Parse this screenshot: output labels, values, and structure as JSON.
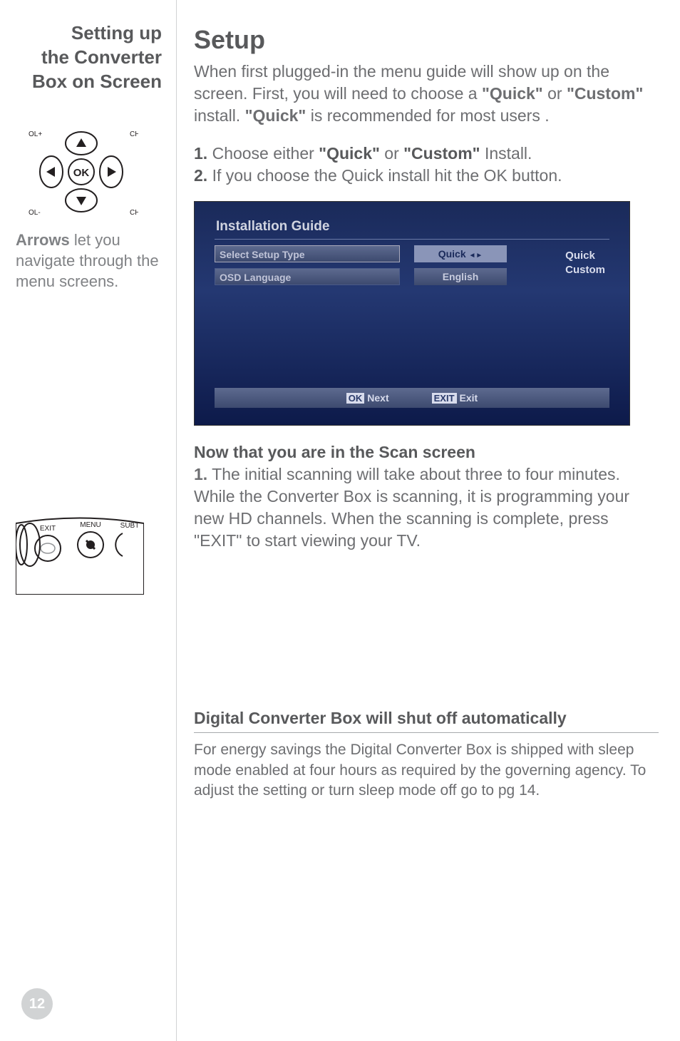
{
  "sidebar": {
    "title_line1": "Setting up",
    "title_line2": "the Converter",
    "title_line3": "Box on Screen",
    "arrows_desc_prefix": "Arrows",
    "arrows_desc_rest": " let you navigate through the menu screens.",
    "remote_labels": {
      "exit": "EXIT",
      "menu": "MENU",
      "subt": "SUBT"
    },
    "dpad_labels": {
      "ok": "OK",
      "volup": "OL+",
      "voldn": "OL-",
      "chup": "CH",
      "chdn": "CH"
    }
  },
  "main": {
    "h1": "Setup",
    "intro_pre": "When first plugged-in the menu guide will show up on the screen. First, you will need to choose a ",
    "quick": "\"Quick\"",
    "or": " or ",
    "custom": "\"Custom\"",
    "intro_post": " install. ",
    "intro_rec_pre": "\"Quick\"",
    "intro_rec_post": " is recommended for most users  .",
    "step1_num": "1.",
    "step1_pre": " Choose either ",
    "step1_post": " Install.",
    "step2_num": "2.",
    "step2_text": " If you choose the Quick install hit the OK button.",
    "scan_heading": "Now that you are in the Scan screen",
    "scan_body_num": "1.",
    "scan_body": " The initial scanning will take about three to four minutes. While the Converter Box is scanning, it is programming your new HD channels. When the scanning is complete, press \"EXIT\" to start viewing your TV.",
    "shutoff_heading": "Digital Converter Box will shut off automatically",
    "shutoff_body": "For energy savings the Digital Converter Box is shipped with sleep mode enabled at four hours as required by the governing agency. To adjust the setting or turn sleep mode off go to pg 14."
  },
  "osd": {
    "title": "Installation Guide",
    "row1_label": "Select Setup Type",
    "row1_value": "Quick",
    "row2_label": "OSD Language",
    "row2_value": "English",
    "side1": "Quick",
    "side2": "Custom",
    "footer_ok_key": "OK",
    "footer_ok_label": "Next",
    "footer_exit_key": "EXIT",
    "footer_exit_label": "Exit"
  },
  "page_number": "12"
}
